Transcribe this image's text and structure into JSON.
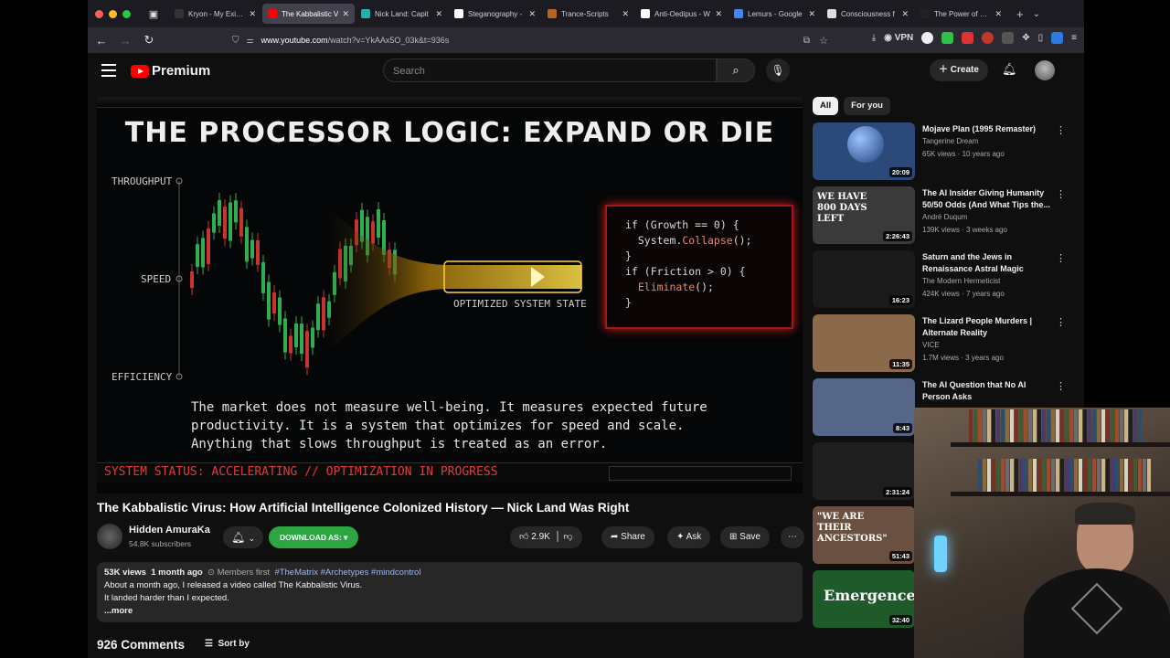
{
  "browser": {
    "tabs": [
      {
        "label": "Kryon - My Existe",
        "icon_color": "#333333"
      },
      {
        "label": "The Kabbalistic V",
        "icon_color": "#ff0000",
        "active": true
      },
      {
        "label": "Nick Land: Capit",
        "icon_color": "#20b2aa"
      },
      {
        "label": "Steganography -",
        "icon_color": "#ffffff"
      },
      {
        "label": "Trance-Scripts",
        "icon_color": "#b5651d"
      },
      {
        "label": "Anti-Oedipus - W",
        "icon_color": "#ffffff"
      },
      {
        "label": "Lemurs - Google",
        "icon_color": "#4285f4"
      },
      {
        "label": "Consciousness f",
        "icon_color": "#dddddd"
      },
      {
        "label": "The Power of Zero -",
        "icon_color": "#222222"
      }
    ],
    "url_host": "www.youtube.com",
    "url_path": "/watch?v=YkAAx5O_03k&t=936s",
    "vpn_label": "VPN"
  },
  "youtube": {
    "logo_text": "Premium",
    "search_placeholder": "Search",
    "create_label": "Create"
  },
  "video_frame": {
    "title": "THE PROCESSOR LOGIC: EXPAND OR DIE",
    "axis_labels": [
      "THROUGHPUT",
      "SPEED",
      "EFFICIENCY"
    ],
    "code_lines": [
      "if (Growth == 0) {",
      "  System.Collapse();",
      "}",
      "if (Friction > 0) {",
      "  Eliminate();",
      "}"
    ],
    "optimized_label": "OPTIMIZED SYSTEM STATE",
    "paragraph": [
      "The market does not measure well-being. It measures expected future",
      "productivity. It is a system that optimizes for speed and scale.",
      "Anything that slows throughput is treated as an error."
    ],
    "status": "SYSTEM STATUS: ACCELERATING // OPTIMIZATION IN PROGRESS"
  },
  "video": {
    "title": "The Kabbalistic Virus: How Artificial Intelligence Colonized History — Nick Land Was Right",
    "channel": "Hidden AmuraKa",
    "subscribers": "54.8K subscribers",
    "download_label": "DOWNLOAD AS: ▾",
    "likes": "2.9K",
    "share_label": "Share",
    "ask_label": "Ask",
    "save_label": "Save"
  },
  "description": {
    "views": "53K views",
    "age": "1 month ago",
    "members": "Members first",
    "tags": "#TheMatrix #Archetypes #mindcontrol",
    "line1": "About a month ago, I released a video called The Kabbalistic Virus.",
    "line2": "It landed harder than I expected.",
    "more": "...more"
  },
  "comments": {
    "count": "926 Comments",
    "sort_label": "Sort by"
  },
  "chips": [
    "All",
    "For you"
  ],
  "recommendations": [
    {
      "title": "Mojave Plan (1995 Remaster)",
      "channel": "Tangerine Dream",
      "meta": "65K views · 10 years ago",
      "duration": "20:09",
      "thumb": "#2b4a7a"
    },
    {
      "title": "The AI Insider Giving Humanity 50/50 Odds (And What Tips the...",
      "channel": "André Duqum",
      "meta": "139K views · 3 weeks ago",
      "duration": "2:26:43",
      "thumb_text": "WE HAVE 800 DAYS LEFT",
      "thumb": "#3a3a3a"
    },
    {
      "title": "Saturn and the Jews in Renaissance Astral Magic",
      "channel": "The Modern Hermeticist",
      "meta": "424K views · 7 years ago",
      "duration": "16:23",
      "thumb": "#1a1a1a"
    },
    {
      "title": "The Lizard People Murders | Alternate Reality",
      "channel": "VICE",
      "meta": "1.7M views · 3 years ago",
      "duration": "11:35",
      "thumb": "#8a6a4a"
    },
    {
      "title": "The AI Question that No AI Person Asks",
      "channel": "",
      "meta": "",
      "duration": "8:43",
      "thumb": "#556688"
    },
    {
      "title": "",
      "channel": "",
      "meta": "",
      "duration": "2:31:24",
      "thumb": "#1e1e1e"
    },
    {
      "title": "",
      "channel": "",
      "meta": "",
      "duration": "51:43",
      "thumb": "#6a5040",
      "thumb_text": "\"WE ARE THEIR ANCESTORS\""
    },
    {
      "title": "",
      "channel": "",
      "meta": "",
      "duration": "32:40",
      "thumb": "#1f5a2a",
      "thumb_text": "Emergence"
    }
  ]
}
